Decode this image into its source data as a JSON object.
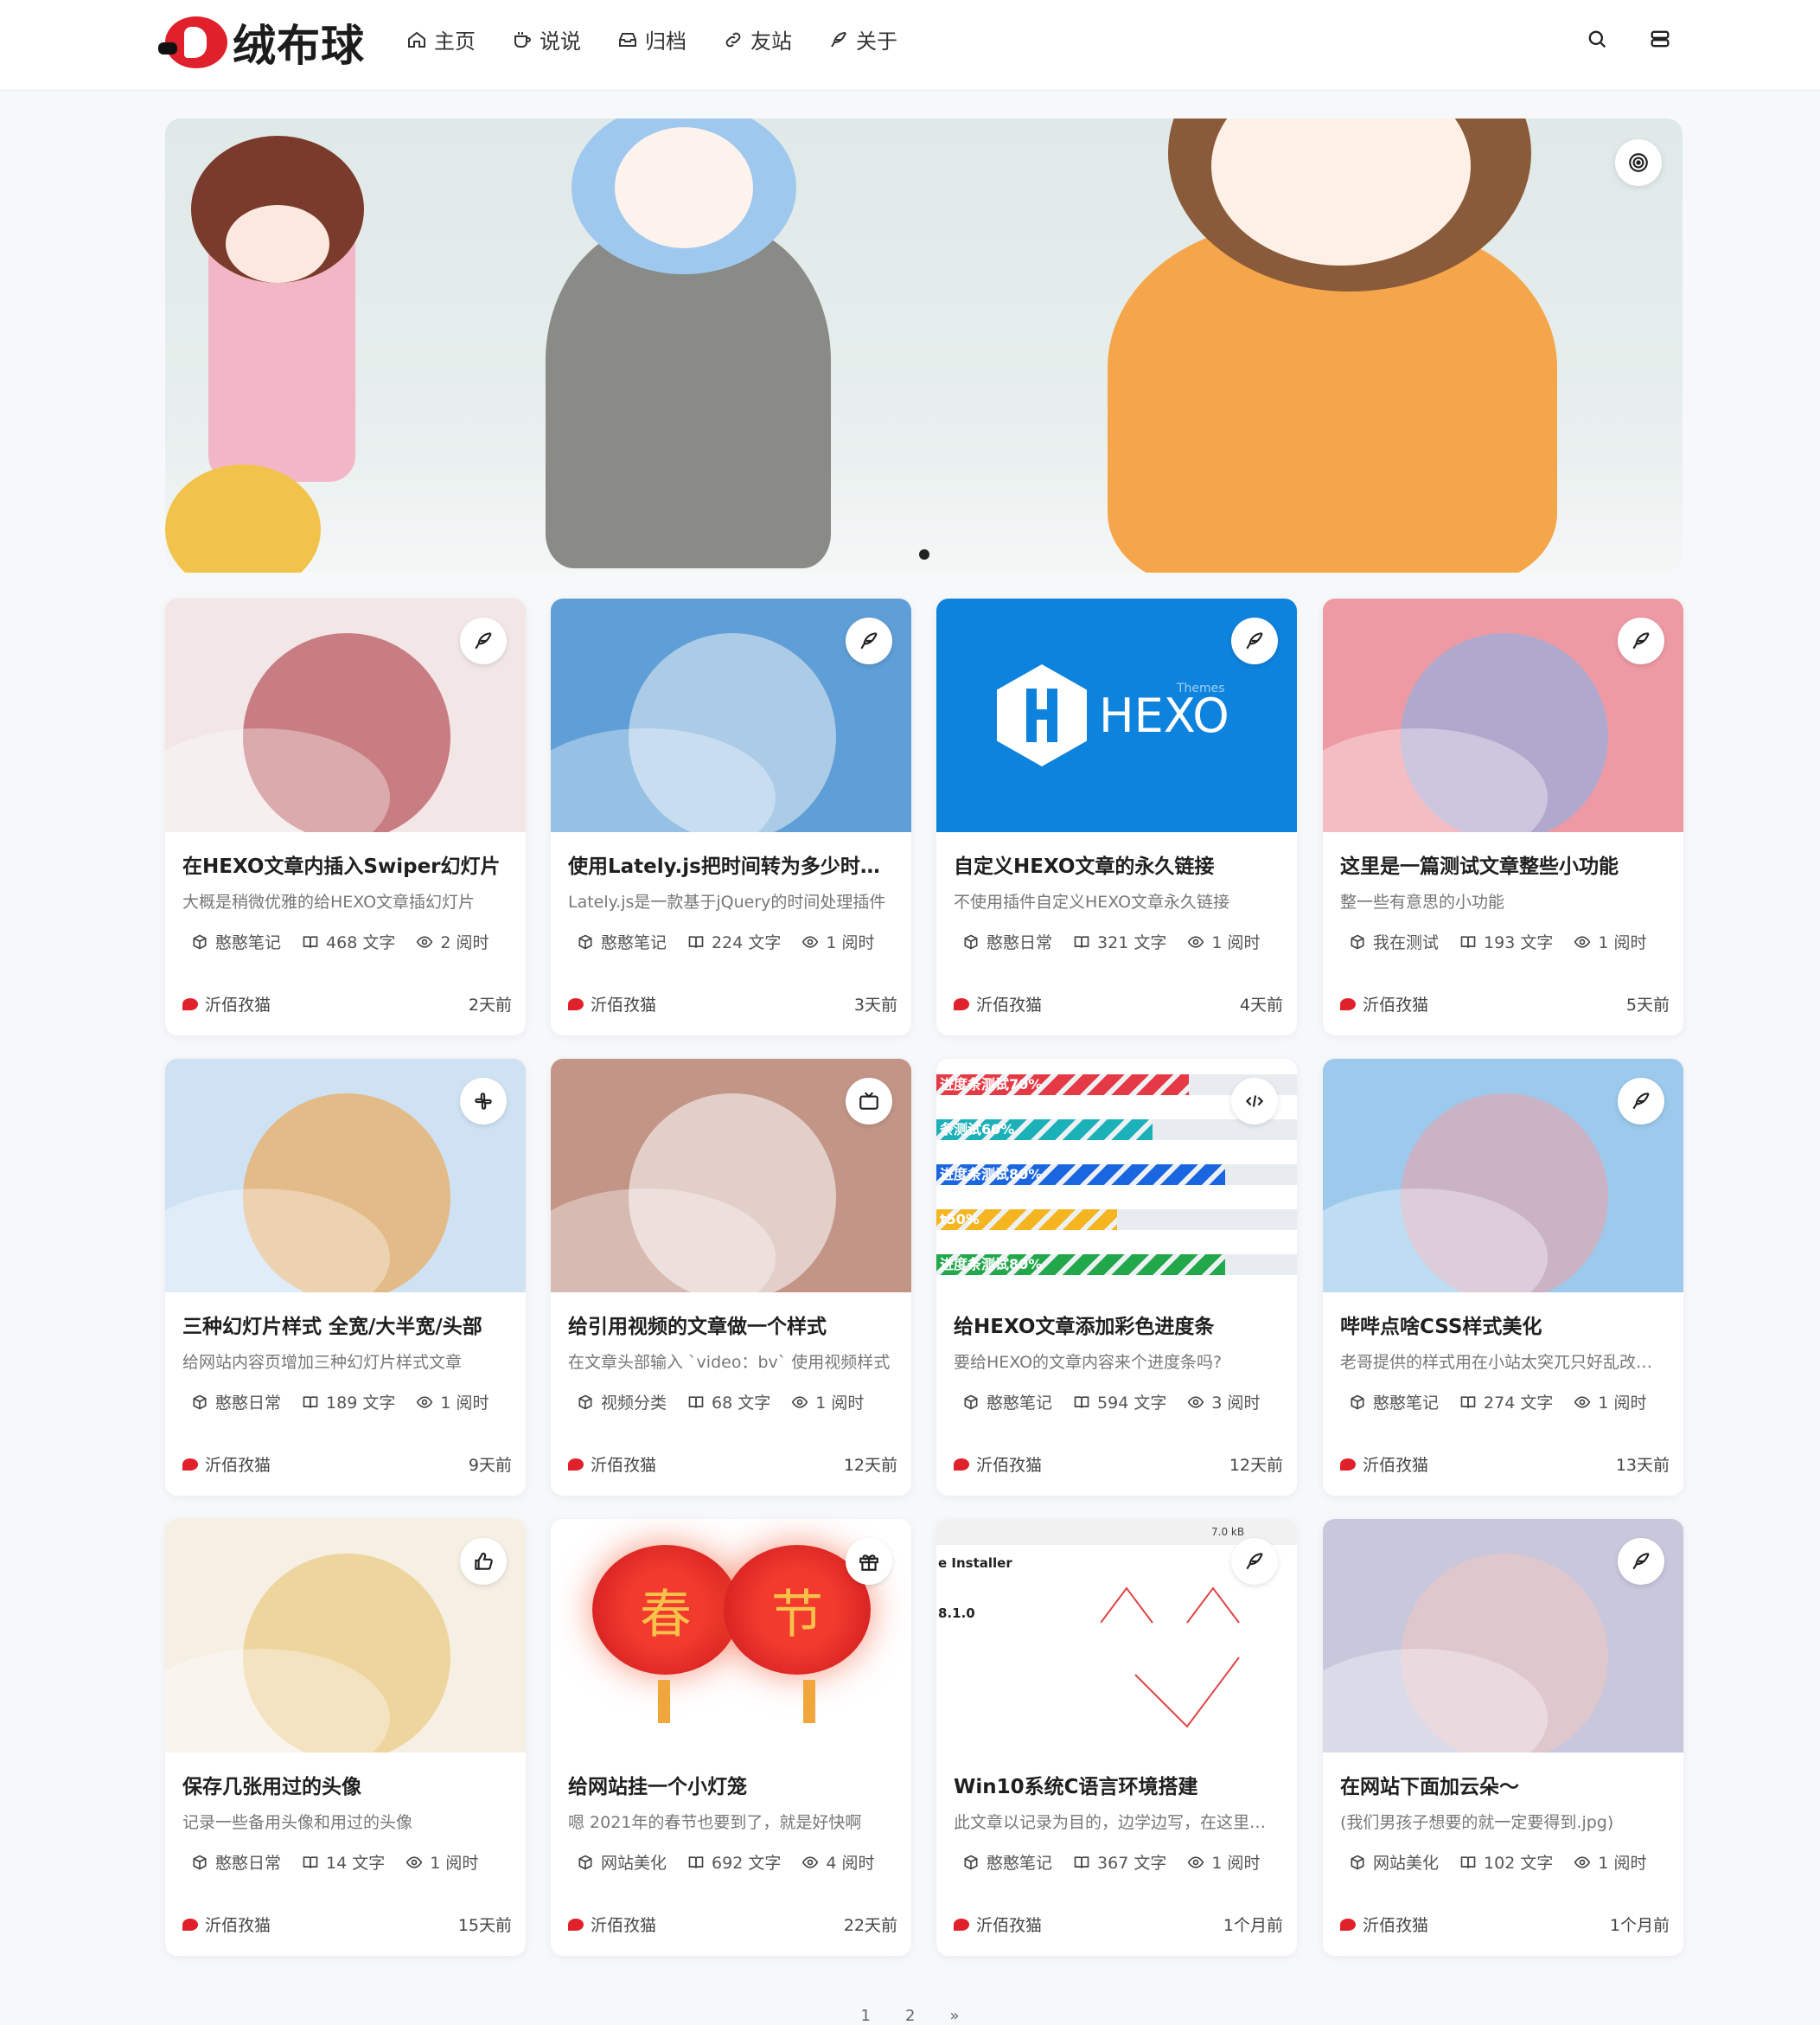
{
  "site": {
    "logo_text": "绒布球"
  },
  "nav": [
    {
      "label": "主页",
      "icon": "home-icon"
    },
    {
      "label": "说说",
      "icon": "cup-icon"
    },
    {
      "label": "归档",
      "icon": "archive-icon"
    },
    {
      "label": "友站",
      "icon": "link-icon"
    },
    {
      "label": "关于",
      "icon": "feather-icon"
    }
  ],
  "header_actions": [
    "search-icon",
    "menu-icon"
  ],
  "banner": {
    "icon": "target-icon",
    "active_slide": 1
  },
  "posts": [
    {
      "title": "在HEXO文章内插入Swiper幻灯片",
      "desc": "大概是稍微优雅的给HEXO文章插幻灯片",
      "category": "憨憨笔记",
      "words": "468 文字",
      "read": "2 阅时",
      "author": "沂佰孜猫",
      "time": "2天前",
      "badge": "feather-icon",
      "bg": "#f2e6e6",
      "accent": "#a5272f"
    },
    {
      "title": "使用Lately.js把时间转为多少时间前",
      "desc": "Lately.js是一款基于jQuery的时间处理插件",
      "category": "憨憨笔记",
      "words": "224 文字",
      "read": "1 阅时",
      "author": "沂佰孜猫",
      "time": "3天前",
      "badge": "feather-icon",
      "bg": "#5f9ed6",
      "accent": "#e9f0f5"
    },
    {
      "title": "自定义HEXO文章的永久链接",
      "desc": "不使用插件自定义HEXO文章永久链接",
      "category": "憨憨日常",
      "words": "321 文字",
      "read": "1 阅时",
      "author": "沂佰孜猫",
      "time": "4天前",
      "badge": "feather-icon",
      "bg": "#0e83dd",
      "accent": "#ffffff",
      "img_label": "HEXO",
      "img_small": "Themes"
    },
    {
      "title": "这里是一篇测试文章整些小功能",
      "desc": "整一些有意思的小功能",
      "category": "我在测试",
      "words": "193 文字",
      "read": "1 阅时",
      "author": "沂佰孜猫",
      "time": "5天前",
      "badge": "feather-icon",
      "bg": "#ee9aa4",
      "accent": "#7fb7ee"
    },
    {
      "title": "三种幻灯片样式 全宽/大半宽/头部",
      "desc": "给网站内容页增加三种幻灯片样式文章",
      "category": "憨憨日常",
      "words": "189 文字",
      "read": "1 阅时",
      "author": "沂佰孜猫",
      "time": "9天前",
      "badge": "slack-icon",
      "bg": "#cfe2f4",
      "accent": "#f39a2f"
    },
    {
      "title": "给引用视频的文章做一个样式",
      "desc": "在文章头部输入 `video：bv` 使用视频样式",
      "category": "视频分类",
      "words": "68 文字",
      "read": "1 阅时",
      "author": "沂佰孜猫",
      "time": "12天前",
      "badge": "tv-icon",
      "bg": "#c29587",
      "accent": "#ffffff"
    },
    {
      "title": "给HEXO文章添加彩色进度条",
      "desc": "要给HEXO的文章内容来个进度条吗?",
      "category": "憨憨笔记",
      "words": "594 文字",
      "read": "3 阅时",
      "author": "沂佰孜猫",
      "time": "12天前",
      "badge": "code-icon",
      "bg": "#ffffff",
      "accent": "#e53945",
      "bars": [
        {
          "label": "进度条测试70%",
          "pct": 70,
          "color": "#e53945"
        },
        {
          "label": "条测试60%",
          "pct": 60,
          "color": "#1cb0b8"
        },
        {
          "label": "进度条测试80%",
          "pct": 80,
          "color": "#1a66e0"
        },
        {
          "label": "t50%",
          "pct": 50,
          "color": "#f4b520"
        },
        {
          "label": "进度条测试80%",
          "pct": 80,
          "color": "#22a84b"
        }
      ]
    },
    {
      "title": "哔哔点啥CSS样式美化",
      "desc": "老哥提供的样式用在小站太突兀只好乱改一通",
      "category": "憨憨笔记",
      "words": "274 文字",
      "read": "1 阅时",
      "author": "沂佰孜猫",
      "time": "13天前",
      "badge": "feather-icon",
      "bg": "#9cc9ec",
      "accent": "#f2a0a8"
    },
    {
      "title": "保存几张用过的头像",
      "desc": "记录一些备用头像和用过的头像",
      "category": "憨憨日常",
      "words": "14 文字",
      "read": "1 阅时",
      "author": "沂佰孜猫",
      "time": "15天前",
      "badge": "thumbs-up-icon",
      "bg": "#f6efe4",
      "accent": "#e8c064"
    },
    {
      "title": "给网站挂一个小灯笼",
      "desc": "嗯 2021年的春节也要到了，就是好快啊",
      "category": "网站美化",
      "words": "692 文字",
      "read": "4 阅时",
      "author": "沂佰孜猫",
      "time": "22天前",
      "badge": "gift-icon",
      "bg": "#ffffff",
      "accent": "#d91f26",
      "lantern_left": "春",
      "lantern_right": "节"
    },
    {
      "title": "Win10系统C语言环境搭建",
      "desc": "此文章以记录为目的，边学边写，在这里记录",
      "category": "憨憨笔记",
      "words": "367 文字",
      "read": "1 阅时",
      "author": "沂佰孜猫",
      "time": "1个月前",
      "badge": "feather-icon",
      "bg": "#ffffff",
      "accent": "#e04444",
      "img_line1": "e Installer",
      "img_line2": "8.1.0",
      "img_size": "7.0 kB"
    },
    {
      "title": "在网站下面加云朵～",
      "desc": "(我们男孩子想要的就一定要得到.jpg)",
      "category": "网站美化",
      "words": "102 文字",
      "read": "1 阅时",
      "author": "沂佰孜猫",
      "time": "1个月前",
      "badge": "feather-icon",
      "bg": "#c8c7dc",
      "accent": "#f2c7c3"
    }
  ],
  "pagination": [
    "1",
    "2",
    "»"
  ]
}
